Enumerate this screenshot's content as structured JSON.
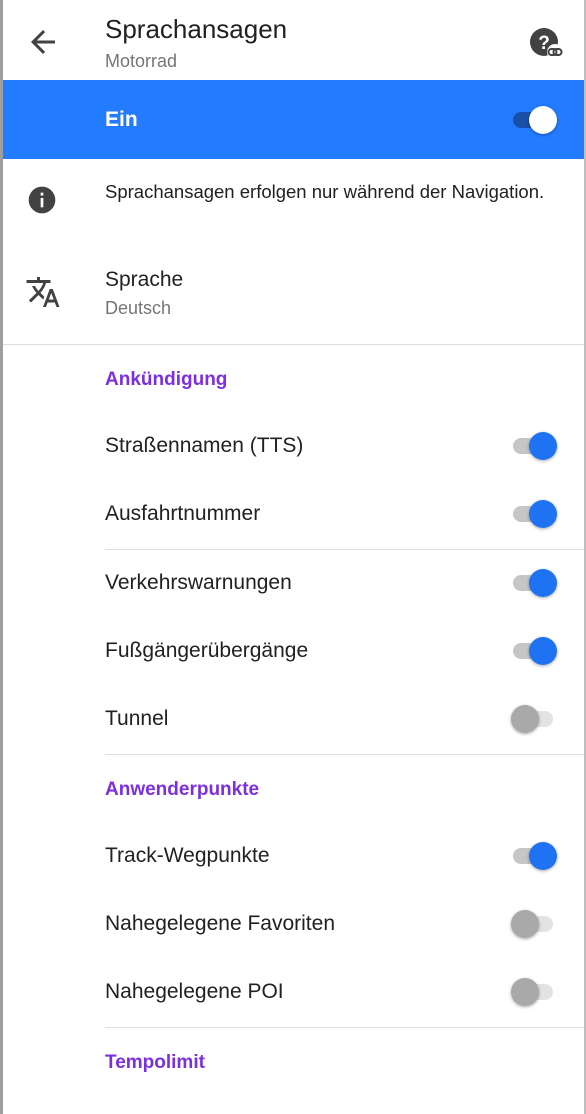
{
  "header": {
    "title": "Sprachansagen",
    "subtitle": "Motorrad",
    "back_icon": "arrow-left-icon",
    "help_icon": "help-link-icon"
  },
  "master": {
    "label": "Ein",
    "enabled": true,
    "color": "#237bff"
  },
  "info": {
    "icon": "info-icon",
    "text": "Sprachansagen erfolgen nur während der Navigation."
  },
  "language": {
    "icon": "translate-icon",
    "title": "Sprache",
    "value": "Deutsch"
  },
  "sections": {
    "announcement": {
      "title": "Ankündigung",
      "items": [
        {
          "label": "Straßennamen (TTS)",
          "enabled": true
        },
        {
          "label": "Ausfahrtnummer",
          "enabled": true
        },
        {
          "label": "Verkehrswarnungen",
          "enabled": true
        },
        {
          "label": "Fußgängerübergänge",
          "enabled": true
        },
        {
          "label": "Tunnel",
          "enabled": false
        }
      ]
    },
    "user_points": {
      "title": "Anwenderpunkte",
      "items": [
        {
          "label": "Track-Wegpunkte",
          "enabled": true
        },
        {
          "label": "Nahegelegene Favoriten",
          "enabled": false
        },
        {
          "label": "Nahegelegene POI",
          "enabled": false
        }
      ]
    },
    "speed_limit": {
      "title": "Tempolimit"
    }
  },
  "colors": {
    "accent": "#1f73f2",
    "section_title": "#7d2fe0"
  }
}
